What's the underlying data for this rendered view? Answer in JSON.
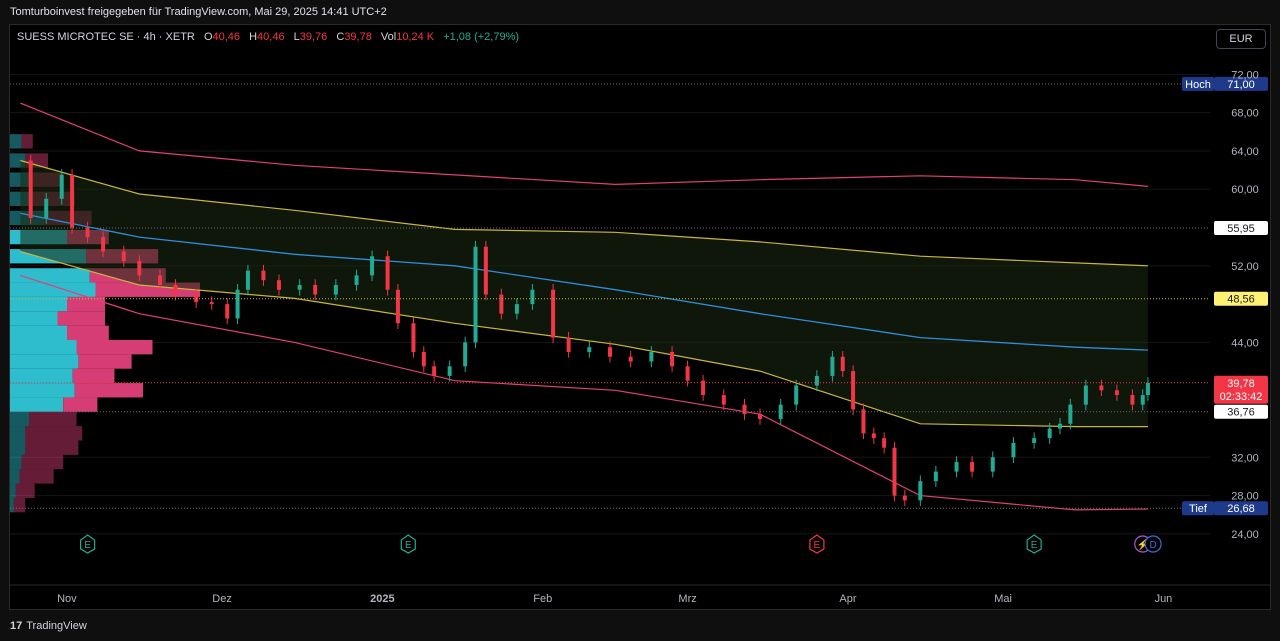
{
  "header": {
    "shared_by": "Tomturboinvest freigegeben für TradingView.com, Mai 29, 2025 14:41 UTC+2"
  },
  "legend": {
    "symbol": "SUESS MICROTEC SE · 4h · XETR",
    "open_label": "O",
    "open_value": "40,46",
    "high_label": "H",
    "high_value": "40,46",
    "low_label": "L",
    "low_value": "39,76",
    "close_label": "C",
    "close_value": "39,78",
    "vol_label": "Vol",
    "vol_value": "10,24 K",
    "change": "+1,08 (+2,79%)"
  },
  "currency_button": "EUR",
  "footer": {
    "brand": "TradingView",
    "logo_mark": "17"
  },
  "colors": {
    "up": "#22ab94",
    "down": "#f23645",
    "vwap": "#2f8cd8",
    "band_inner": "#c8b540",
    "band_outer": "#e0407a",
    "vp_up": "#2fc7d8",
    "vp_down": "#e0407a",
    "badge_blue": "#1e3a8a",
    "badge_yellow": "#fff176",
    "badge_red": "#f23645"
  },
  "chart_data": {
    "type": "candlestick",
    "instrument": "SUESS MICROTEC SE",
    "interval": "4h",
    "exchange": "XETR",
    "currency": "EUR",
    "y_axis": {
      "ticks": [
        "72,00",
        "68,00",
        "64,00",
        "60,00",
        "52,00",
        "44,00",
        "32,00",
        "28,00",
        "24,00"
      ],
      "range": [
        22.0,
        73.5
      ]
    },
    "x_axis": {
      "ticks": [
        "Nov",
        "Dez",
        "2025",
        "Feb",
        "Mrz",
        "Apr",
        "Mai",
        "Jun"
      ]
    },
    "time_range": [
      "2024-10-21",
      "2025-06-10"
    ],
    "price_series": [
      [
        "2024-10-21",
        63.0
      ],
      [
        "2024-10-25",
        57.0
      ],
      [
        "2024-10-28",
        59.0
      ],
      [
        "2024-10-31",
        61.5
      ],
      [
        "2024-11-02",
        56.0
      ],
      [
        "2024-11-05",
        55.0
      ],
      [
        "2024-11-08",
        53.5
      ],
      [
        "2024-11-12",
        52.5
      ],
      [
        "2024-11-15",
        51.0
      ],
      [
        "2024-11-19",
        50.0
      ],
      [
        "2024-11-22",
        49.0
      ],
      [
        "2024-11-26",
        48.2
      ],
      [
        "2024-11-29",
        48.0
      ],
      [
        "2024-12-02",
        46.5
      ],
      [
        "2024-12-04",
        49.5
      ],
      [
        "2024-12-06",
        51.5
      ],
      [
        "2024-12-09",
        50.5
      ],
      [
        "2024-12-12",
        49.5
      ],
      [
        "2024-12-16",
        50.0
      ],
      [
        "2024-12-19",
        49.0
      ],
      [
        "2024-12-23",
        50.0
      ],
      [
        "2024-12-27",
        51.0
      ],
      [
        "2024-12-30",
        53.0
      ],
      [
        "2025-01-02",
        49.5
      ],
      [
        "2025-01-04",
        46.0
      ],
      [
        "2025-01-07",
        43.0
      ],
      [
        "2025-01-09",
        41.5
      ],
      [
        "2025-01-11",
        40.5
      ],
      [
        "2025-01-14",
        41.5
      ],
      [
        "2025-01-17",
        44.0
      ],
      [
        "2025-01-19",
        54.0
      ],
      [
        "2025-01-21",
        49.0
      ],
      [
        "2025-01-24",
        47.0
      ],
      [
        "2025-01-27",
        48.0
      ],
      [
        "2025-01-30",
        49.5
      ],
      [
        "2025-02-03",
        44.5
      ],
      [
        "2025-02-06",
        43.0
      ],
      [
        "2025-02-10",
        43.5
      ],
      [
        "2025-02-14",
        42.5
      ],
      [
        "2025-02-18",
        42.0
      ],
      [
        "2025-02-22",
        43.0
      ],
      [
        "2025-02-26",
        41.5
      ],
      [
        "2025-03-01",
        40.0
      ],
      [
        "2025-03-04",
        38.5
      ],
      [
        "2025-03-08",
        37.5
      ],
      [
        "2025-03-12",
        36.5
      ],
      [
        "2025-03-15",
        36.0
      ],
      [
        "2025-03-19",
        37.5
      ],
      [
        "2025-03-22",
        39.5
      ],
      [
        "2025-03-26",
        40.5
      ],
      [
        "2025-03-29",
        42.5
      ],
      [
        "2025-03-31",
        41.0
      ],
      [
        "2025-04-02",
        37.0
      ],
      [
        "2025-04-04",
        34.5
      ],
      [
        "2025-04-06",
        34.0
      ],
      [
        "2025-04-08",
        33.0
      ],
      [
        "2025-04-10",
        28.0
      ],
      [
        "2025-04-12",
        27.5
      ],
      [
        "2025-04-15",
        29.5
      ],
      [
        "2025-04-18",
        30.5
      ],
      [
        "2025-04-22",
        31.5
      ],
      [
        "2025-04-25",
        30.5
      ],
      [
        "2025-04-29",
        32.0
      ],
      [
        "2025-05-03",
        33.5
      ],
      [
        "2025-05-07",
        34.0
      ],
      [
        "2025-05-10",
        35.0
      ],
      [
        "2025-05-12",
        35.5
      ],
      [
        "2025-05-14",
        37.5
      ],
      [
        "2025-05-17",
        39.5
      ],
      [
        "2025-05-20",
        39.0
      ],
      [
        "2025-05-23",
        38.5
      ],
      [
        "2025-05-26",
        37.5
      ],
      [
        "2025-05-28",
        38.5
      ],
      [
        "2025-05-29",
        39.78
      ]
    ],
    "anchored_vwap": [
      [
        "2024-10-23",
        57.5
      ],
      [
        "2024-11-15",
        55.0
      ],
      [
        "2024-12-15",
        53.2
      ],
      [
        "2025-01-15",
        52.0
      ],
      [
        "2025-02-15",
        49.5
      ],
      [
        "2025-03-15",
        47.0
      ],
      [
        "2025-04-15",
        44.5
      ],
      [
        "2025-05-15",
        43.5
      ],
      [
        "2025-05-29",
        43.2
      ]
    ],
    "band_upper_inner": [
      [
        "2024-10-23",
        63.0
      ],
      [
        "2024-11-15",
        59.5
      ],
      [
        "2024-12-15",
        57.8
      ],
      [
        "2025-01-15",
        55.8
      ],
      [
        "2025-02-15",
        55.5
      ],
      [
        "2025-03-15",
        54.5
      ],
      [
        "2025-04-15",
        53.0
      ],
      [
        "2025-05-15",
        52.3
      ],
      [
        "2025-05-29",
        52.0
      ]
    ],
    "band_lower_inner": [
      [
        "2024-10-23",
        53.5
      ],
      [
        "2024-11-15",
        50.0
      ],
      [
        "2024-12-15",
        48.6
      ],
      [
        "2025-01-15",
        46.0
      ],
      [
        "2025-02-15",
        43.8
      ],
      [
        "2025-03-15",
        41.0
      ],
      [
        "2025-04-15",
        35.5
      ],
      [
        "2025-05-15",
        35.2
      ],
      [
        "2025-05-29",
        35.2
      ]
    ],
    "band_upper_outer": [
      [
        "2024-10-23",
        69.0
      ],
      [
        "2024-11-15",
        64.0
      ],
      [
        "2024-12-15",
        62.5
      ],
      [
        "2025-01-15",
        61.5
      ],
      [
        "2025-02-15",
        60.5
      ],
      [
        "2025-03-15",
        61.0
      ],
      [
        "2025-04-15",
        61.4
      ],
      [
        "2025-05-15",
        61.0
      ],
      [
        "2025-05-29",
        60.3
      ]
    ],
    "band_lower_outer": [
      [
        "2024-10-23",
        51.0
      ],
      [
        "2024-11-15",
        47.0
      ],
      [
        "2024-12-15",
        44.0
      ],
      [
        "2025-01-15",
        40.0
      ],
      [
        "2025-02-15",
        39.0
      ],
      [
        "2025-03-15",
        36.5
      ],
      [
        "2025-04-15",
        28.0
      ],
      [
        "2025-05-15",
        26.5
      ],
      [
        "2025-05-29",
        26.6
      ]
    ],
    "volume_profile": {
      "levels": [
        {
          "price": 65.0,
          "up": 0.06,
          "down": 0.06
        },
        {
          "price": 63.0,
          "up": 0.08,
          "down": 0.12
        },
        {
          "price": 61.0,
          "up": 0.1,
          "down": 0.18
        },
        {
          "price": 59.0,
          "up": 0.12,
          "down": 0.22
        },
        {
          "price": 57.0,
          "up": 0.18,
          "down": 0.25
        },
        {
          "price": 55.0,
          "up": 0.3,
          "down": 0.22
        },
        {
          "price": 53.0,
          "up": 0.4,
          "down": 0.38
        },
        {
          "price": 51.0,
          "up": 0.42,
          "down": 0.4
        },
        {
          "price": 49.5,
          "up": 0.45,
          "down": 0.55
        },
        {
          "price": 48.0,
          "up": 0.3,
          "down": 0.2
        },
        {
          "price": 46.5,
          "up": 0.25,
          "down": 0.25
        },
        {
          "price": 45.0,
          "up": 0.3,
          "down": 0.22
        },
        {
          "price": 43.5,
          "up": 0.35,
          "down": 0.4
        },
        {
          "price": 42.0,
          "up": 0.36,
          "down": 0.28
        },
        {
          "price": 40.5,
          "up": 0.33,
          "down": 0.22
        },
        {
          "price": 39.0,
          "up": 0.34,
          "down": 0.36
        },
        {
          "price": 37.5,
          "up": 0.28,
          "down": 0.18
        },
        {
          "price": 36.0,
          "up": 0.1,
          "down": 0.25
        },
        {
          "price": 34.5,
          "up": 0.08,
          "down": 0.3
        },
        {
          "price": 33.0,
          "up": 0.08,
          "down": 0.28
        },
        {
          "price": 31.5,
          "up": 0.06,
          "down": 0.22
        },
        {
          "price": 30.0,
          "up": 0.05,
          "down": 0.18
        },
        {
          "price": 28.5,
          "up": 0.03,
          "down": 0.1
        },
        {
          "price": 27.0,
          "up": 0.02,
          "down": 0.06
        }
      ],
      "value_area": [
        36.76,
        55.95
      ]
    },
    "horizontal_levels": [
      {
        "label": "Hoch",
        "value": "71,00",
        "price": 71.0,
        "style": "blue"
      },
      {
        "label": "",
        "value": "55,95",
        "price": 55.95,
        "style": "white"
      },
      {
        "label": "",
        "value": "48,56",
        "price": 48.56,
        "style": "yellow"
      },
      {
        "label": "",
        "value": "39,78",
        "sub": "02:33:42",
        "price": 39.78,
        "style": "red"
      },
      {
        "label": "",
        "value": "36,76",
        "price": 36.76,
        "style": "white"
      },
      {
        "label": "Tief",
        "value": "26,68",
        "price": 26.68,
        "style": "blue"
      }
    ],
    "events": [
      {
        "date": "2024-11-05",
        "glyph": "E",
        "kind": "earnings-past"
      },
      {
        "date": "2025-01-06",
        "glyph": "E",
        "kind": "earnings-past"
      },
      {
        "date": "2025-03-26",
        "glyph": "E",
        "kind": "earnings-miss"
      },
      {
        "date": "2025-05-07",
        "glyph": "E",
        "kind": "earnings-past"
      },
      {
        "date": "2025-05-28",
        "glyph": "⚡",
        "kind": "split"
      },
      {
        "date": "2025-05-30",
        "glyph": "D",
        "kind": "dividend"
      }
    ]
  }
}
